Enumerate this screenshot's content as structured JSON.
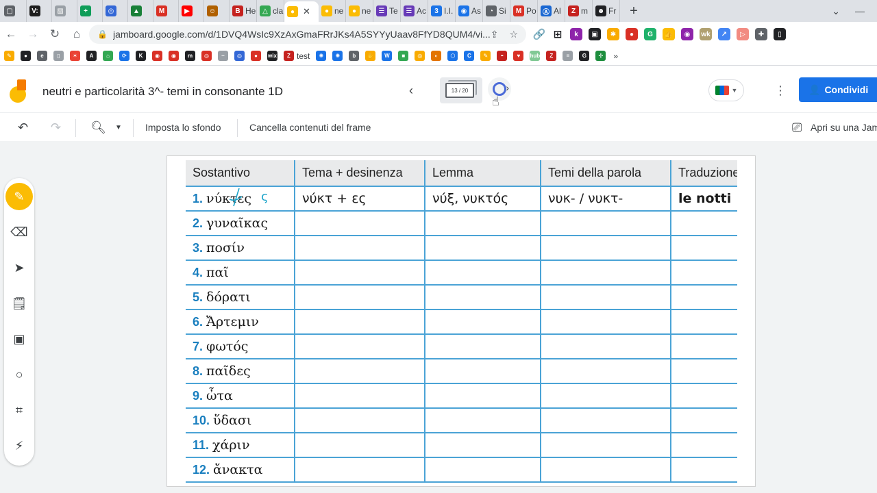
{
  "browser": {
    "tabs": [
      {
        "label": "",
        "color": "#5f6368",
        "glyph": "▢"
      },
      {
        "label": "",
        "color": "#1e1e1e",
        "glyph": "V:"
      },
      {
        "label": "",
        "color": "#9aa0a6",
        "glyph": "▨"
      },
      {
        "label": "",
        "color": "#0f9d58",
        "glyph": "+"
      },
      {
        "label": "",
        "color": "#3367d6",
        "glyph": "◎"
      },
      {
        "label": "",
        "color": "#188038",
        "glyph": "▲"
      },
      {
        "label": "",
        "color": "#d93025",
        "glyph": "M"
      },
      {
        "label": "",
        "color": "#ff0000",
        "glyph": "▶"
      },
      {
        "label": "",
        "color": "#b06000",
        "glyph": "☺"
      },
      {
        "label": "He",
        "color": "#c5221f",
        "glyph": "B"
      },
      {
        "label": "cla",
        "color": "#34a853",
        "glyph": "△"
      },
      {
        "label": "",
        "color": "#fbbc04",
        "glyph": "●",
        "active": true
      },
      {
        "label": "ne",
        "color": "#fbbc04",
        "glyph": "●"
      },
      {
        "label": "ne",
        "color": "#fbbc04",
        "glyph": "●"
      },
      {
        "label": "Te",
        "color": "#673ab7",
        "glyph": "☰"
      },
      {
        "label": "Ac",
        "color": "#673ab7",
        "glyph": "☰"
      },
      {
        "label": "I.I.",
        "color": "#1a73e8",
        "glyph": "3"
      },
      {
        "label": "As",
        "color": "#1a73e8",
        "glyph": "◉"
      },
      {
        "label": "Si",
        "color": "#5f6368",
        "glyph": "◔"
      },
      {
        "label": "Po",
        "color": "#d93025",
        "glyph": "M"
      },
      {
        "label": "Al",
        "color": "#1967d2",
        "glyph": "Ⓐ"
      },
      {
        "label": "m",
        "color": "#c5221f",
        "glyph": "Z"
      },
      {
        "label": "Fr",
        "color": "#202124",
        "glyph": "☻"
      }
    ],
    "new_tab": "+",
    "window_controls": [
      "⌄",
      "—"
    ],
    "url": "jamboard.google.com/d/1DVQ4WsIc9XzAxGmaFRrJKs4A5SYYyUaav8FfYD8QUM4/vi...",
    "extensions": [
      {
        "glyph": "k",
        "color": "#8e24aa"
      },
      {
        "glyph": "▣",
        "color": "#202124"
      },
      {
        "glyph": "✱",
        "color": "#f9ab00"
      },
      {
        "glyph": "●",
        "color": "#d93025"
      },
      {
        "glyph": "G",
        "color": "#1fb26b"
      },
      {
        "glyph": "👍",
        "color": "#fbbc04"
      },
      {
        "glyph": "◉",
        "color": "#8e24aa"
      },
      {
        "glyph": "wk",
        "color": "#b0a070"
      },
      {
        "glyph": "↗",
        "color": "#4285f4"
      },
      {
        "glyph": "▷",
        "color": "#f28b82"
      },
      {
        "glyph": "✚",
        "color": "#5f6368"
      },
      {
        "glyph": "▯",
        "color": "#202124"
      }
    ],
    "bookmarks": [
      {
        "glyph": "✎",
        "color": "#f9ab00"
      },
      {
        "glyph": "●",
        "color": "#202124"
      },
      {
        "glyph": "e",
        "color": "#5f6368"
      },
      {
        "glyph": "▯",
        "color": "#9aa0a6"
      },
      {
        "glyph": "✶",
        "color": "#ea4335"
      },
      {
        "glyph": "A",
        "color": "#202124"
      },
      {
        "glyph": "⌂",
        "color": "#34a853"
      },
      {
        "glyph": "⟳",
        "color": "#1a73e8"
      },
      {
        "glyph": "K",
        "color": "#202124"
      },
      {
        "glyph": "◉",
        "color": "#d93025"
      },
      {
        "glyph": "◉",
        "color": "#d93025"
      },
      {
        "glyph": "m",
        "color": "#202124"
      },
      {
        "glyph": "◎",
        "color": "#d93025"
      },
      {
        "glyph": "~",
        "color": "#9aa0a6"
      },
      {
        "glyph": "◎",
        "color": "#3367d6"
      },
      {
        "glyph": "●",
        "color": "#d93025"
      },
      {
        "glyph": "wix",
        "color": "#202124"
      },
      {
        "glyph": "Z",
        "color": "#c5221f",
        "label": "test"
      },
      {
        "glyph": "✺",
        "color": "#1a73e8"
      },
      {
        "glyph": "✺",
        "color": "#1a73e8"
      },
      {
        "glyph": "b",
        "color": "#5f6368"
      },
      {
        "glyph": "✋",
        "color": "#f9ab00"
      },
      {
        "glyph": "W",
        "color": "#1a73e8"
      },
      {
        "glyph": "■",
        "color": "#34a853"
      },
      {
        "glyph": "◎",
        "color": "#f9ab00"
      },
      {
        "glyph": "◐",
        "color": "#e37400"
      },
      {
        "glyph": "⬡",
        "color": "#1a73e8"
      },
      {
        "glyph": "C",
        "color": "#1a73e8"
      },
      {
        "glyph": "✎",
        "color": "#f9ab00"
      },
      {
        "glyph": "◓",
        "color": "#c5221f"
      },
      {
        "glyph": "♥",
        "color": "#d93025"
      },
      {
        "glyph": "hub",
        "color": "#81c995"
      },
      {
        "glyph": "Z",
        "color": "#c5221f"
      },
      {
        "glyph": "≡",
        "color": "#9aa0a6"
      },
      {
        "glyph": "G",
        "color": "#202124"
      },
      {
        "glyph": "✣",
        "color": "#1e8e3e"
      }
    ],
    "bookmarks_more": "»"
  },
  "jamboard": {
    "title": "neutri e particolarità 3^- temi in consonante 1D",
    "frame_counter": "13 / 20",
    "share_label": "Condividi",
    "toolbar": {
      "set_background": "Imposta lo sfondo",
      "clear_frame": "Cancella contenuti del frame",
      "open_on": "Apri su una Jam"
    }
  },
  "table": {
    "headers": [
      "Sostantivo",
      "Tema + desinenza",
      "Lemma",
      "Temi della parola",
      "Traduzione"
    ],
    "rows": [
      {
        "num": "1.",
        "word": "νύκτες",
        "tema": "νύκτ + ες",
        "lemma": "νύξ, νυκτός",
        "temi": "νυκ- / νυκτ-",
        "trad": "le notti"
      },
      {
        "num": "2.",
        "word": "γυναῖκας",
        "tema": "",
        "lemma": "",
        "temi": "",
        "trad": ""
      },
      {
        "num": "3.",
        "word": "ποσίν",
        "tema": "",
        "lemma": "",
        "temi": "",
        "trad": ""
      },
      {
        "num": "4.",
        "word": "παῖ",
        "tema": "",
        "lemma": "",
        "temi": "",
        "trad": ""
      },
      {
        "num": "5.",
        "word": "δόρατι",
        "tema": "",
        "lemma": "",
        "temi": "",
        "trad": ""
      },
      {
        "num": "6.",
        "word": "Ἄρτεμιν",
        "tema": "",
        "lemma": "",
        "temi": "",
        "trad": ""
      },
      {
        "num": "7.",
        "word": "φωτός",
        "tema": "",
        "lemma": "",
        "temi": "",
        "trad": ""
      },
      {
        "num": "8.",
        "word": "παῖδες",
        "tema": "",
        "lemma": "",
        "temi": "",
        "trad": ""
      },
      {
        "num": "9.",
        "word": "ὦτα",
        "tema": "",
        "lemma": "",
        "temi": "",
        "trad": ""
      },
      {
        "num": "10.",
        "word": "ὕδασι",
        "tema": "",
        "lemma": "",
        "temi": "",
        "trad": ""
      },
      {
        "num": "11.",
        "word": "χάριν",
        "tema": "",
        "lemma": "",
        "temi": "",
        "trad": ""
      },
      {
        "num": "12.",
        "word": "ἄνακτα",
        "tema": "",
        "lemma": "",
        "temi": "",
        "trad": ""
      }
    ],
    "row1_annotation": "ς"
  }
}
